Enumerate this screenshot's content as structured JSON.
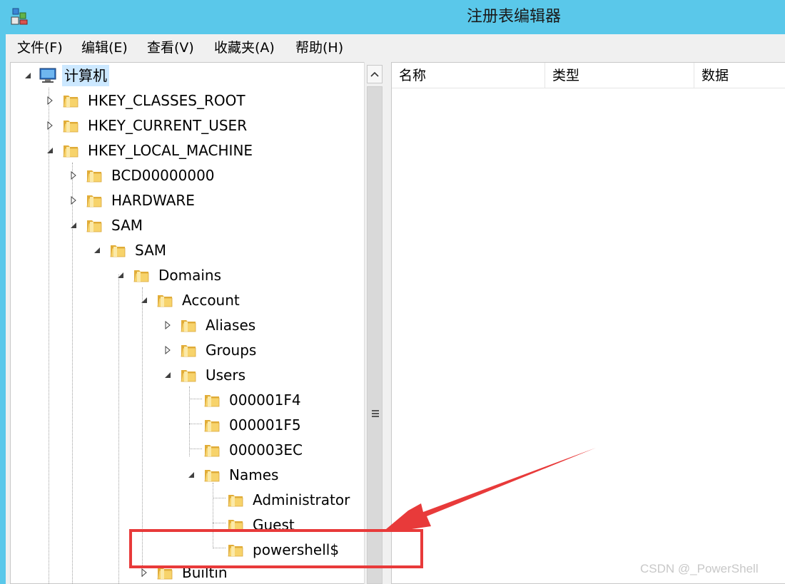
{
  "window": {
    "title": "注册表编辑器",
    "app_icon": "registry-editor-icon"
  },
  "menu": [
    "文件(F)",
    "编辑(E)",
    "查看(V)",
    "收藏夹(A)",
    "帮助(H)"
  ],
  "tree": {
    "root": "计算机",
    "nodes": {
      "hkcr": "HKEY_CLASSES_ROOT",
      "hkcu": "HKEY_CURRENT_USER",
      "hklm": "HKEY_LOCAL_MACHINE",
      "bcd": "BCD00000000",
      "hardware": "HARDWARE",
      "sam1": "SAM",
      "sam2": "SAM",
      "domains": "Domains",
      "account": "Account",
      "aliases": "Aliases",
      "groups": "Groups",
      "users": "Users",
      "u1f4": "000001F4",
      "u1f5": "000001F5",
      "u3ec": "000003EC",
      "names": "Names",
      "administrator": "Administrator",
      "guest": "Guest",
      "powershell": "powershell$",
      "builtin": "Builtin"
    }
  },
  "columns": [
    "名称",
    "类型",
    "数据"
  ],
  "annotation": {
    "color": "#e83a3a",
    "target": "powershell$"
  },
  "watermark": "CSDN @_PowerShell",
  "colors": {
    "titlebar": "#5ac8ea",
    "folder": "#f0c24a",
    "selection": "#cce8ff"
  }
}
